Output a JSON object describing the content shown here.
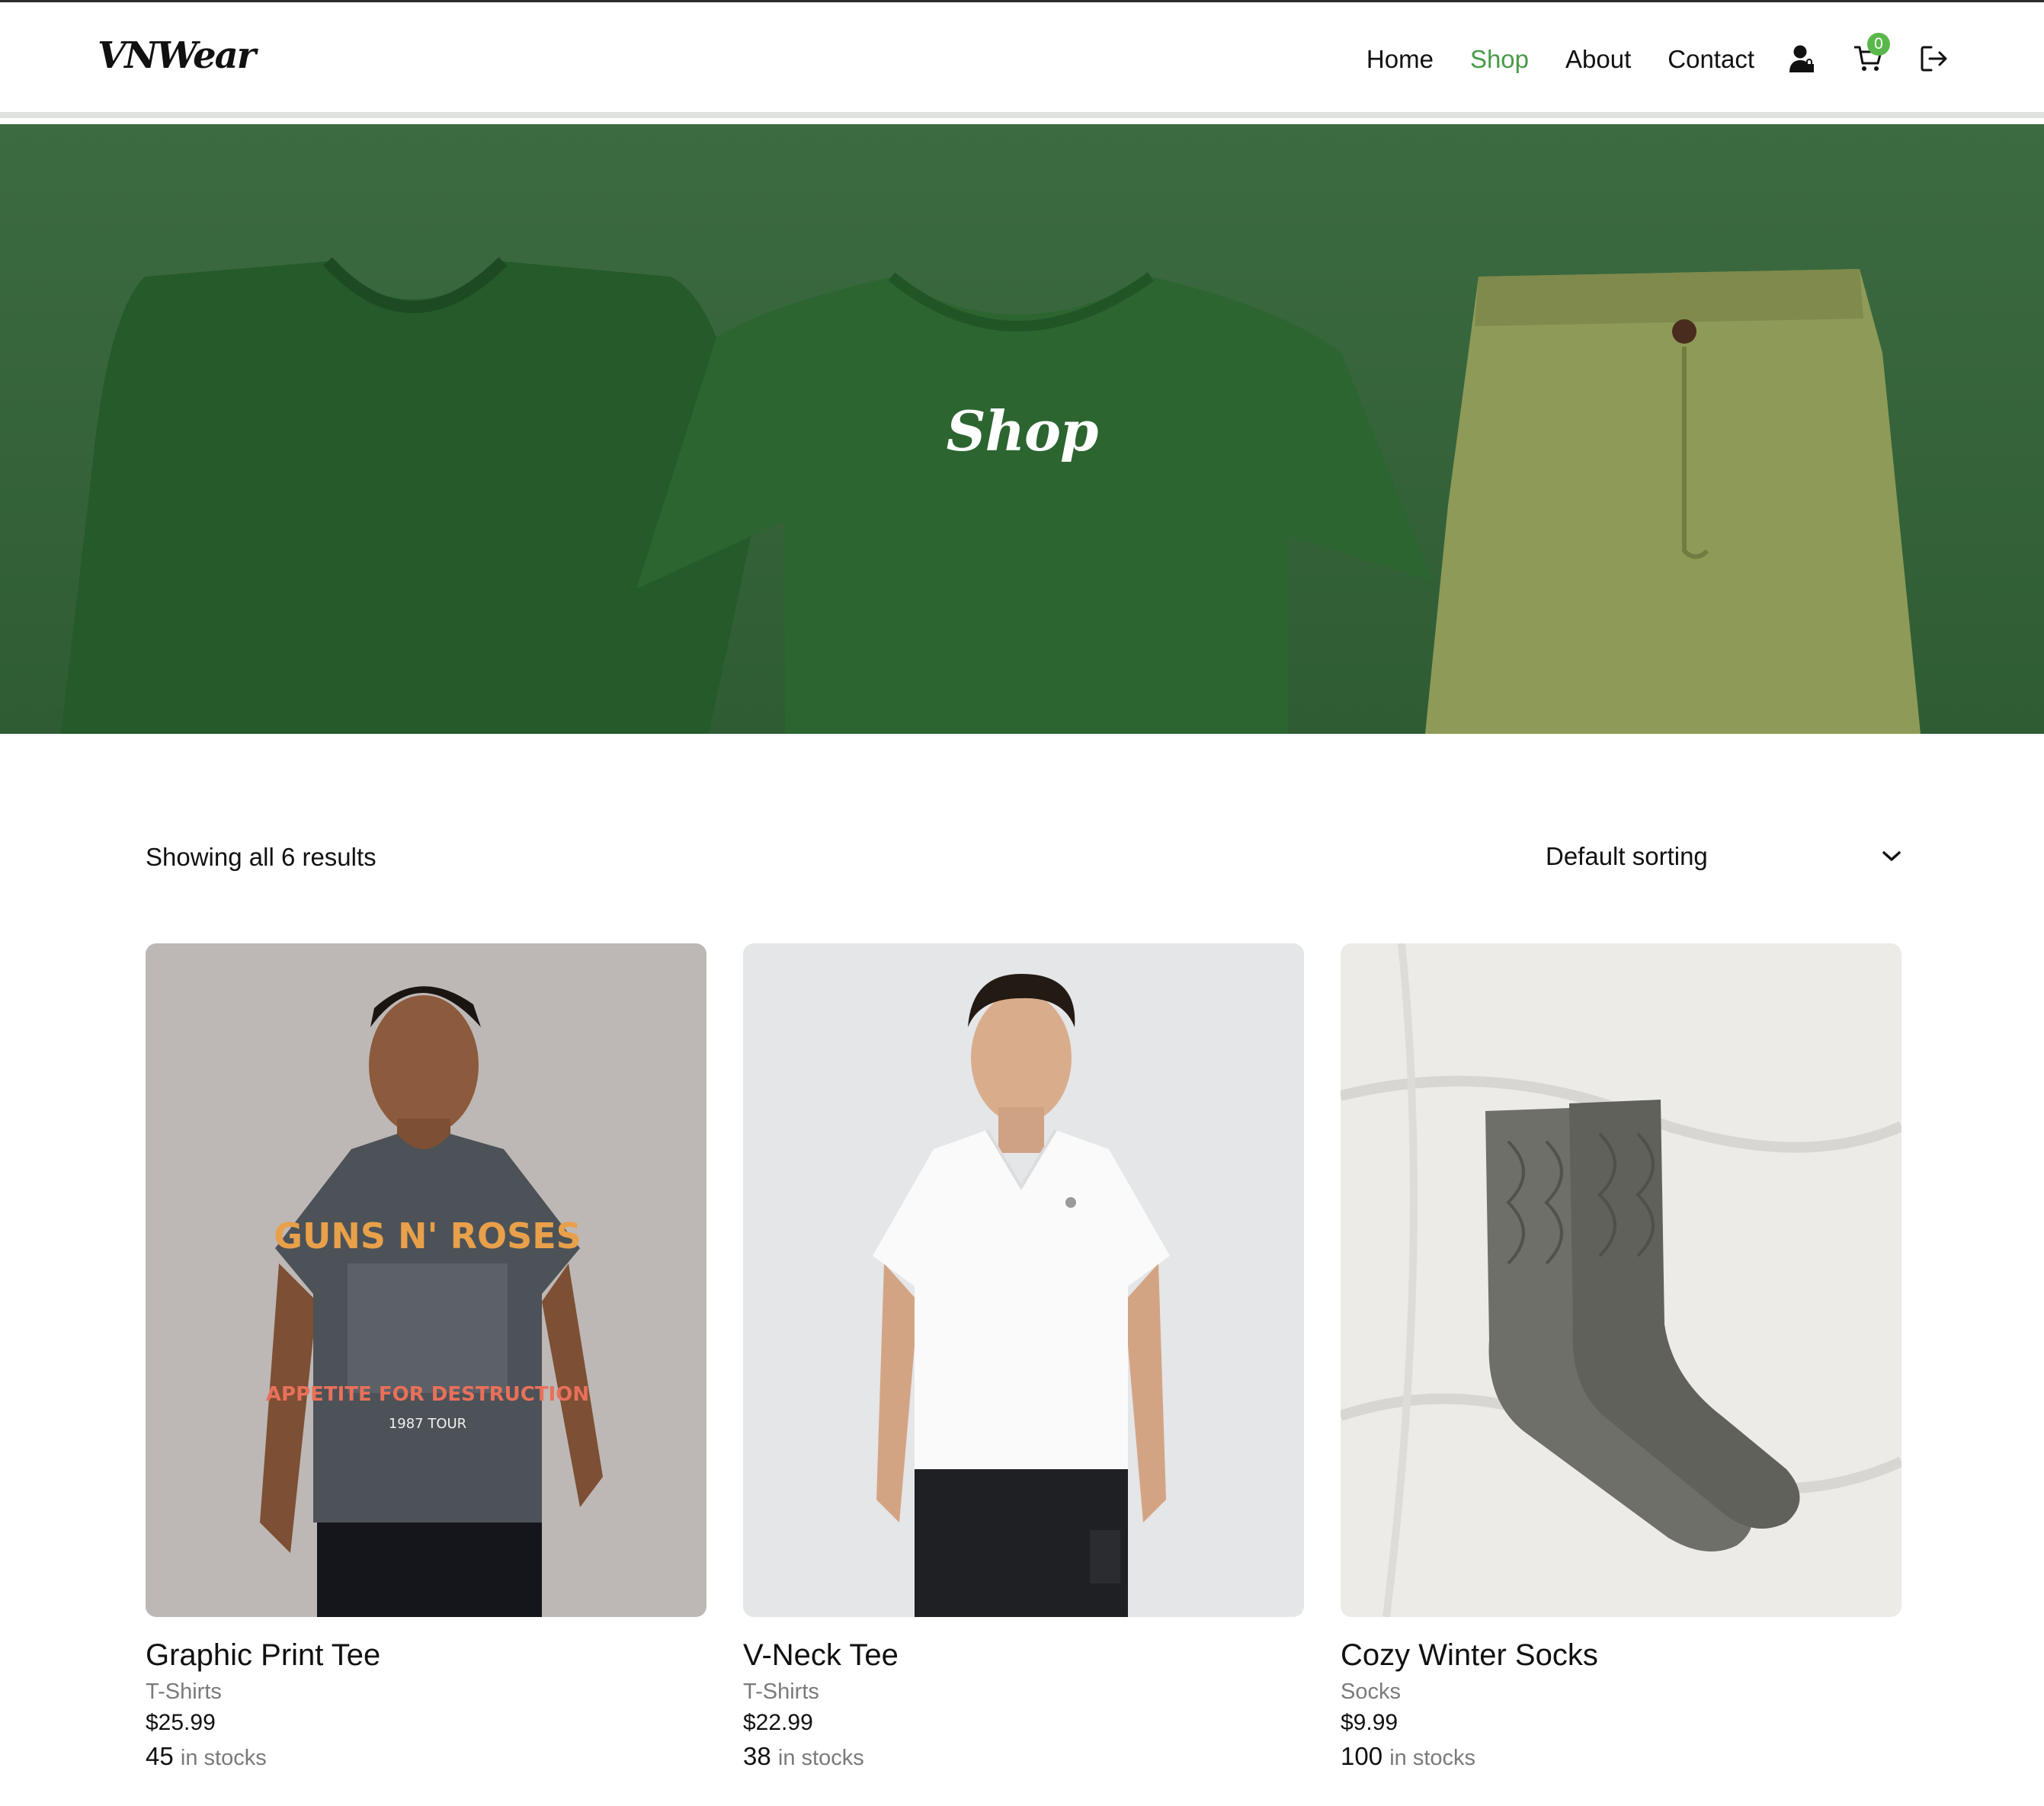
{
  "brand": {
    "logo": "VNWear"
  },
  "nav": {
    "items": [
      {
        "label": "Home",
        "active": false
      },
      {
        "label": "Shop",
        "active": true
      },
      {
        "label": "About",
        "active": false
      },
      {
        "label": "Contact",
        "active": false
      }
    ],
    "icons": [
      "user-icon",
      "cart-icon",
      "logout-icon"
    ],
    "cart_count": "0",
    "active_color": "#4a9a47"
  },
  "hero": {
    "title": "Shop",
    "background_color": "#3a6a3e"
  },
  "toolbar": {
    "result_count": "Showing all 6 results",
    "sort_selected": "Default sorting"
  },
  "products": [
    {
      "name": "Graphic Print Tee",
      "category": "T-Shirts",
      "price": "$25.99",
      "stock": "45",
      "stock_unit": "in stocks"
    },
    {
      "name": "V-Neck Tee",
      "category": "T-Shirts",
      "price": "$22.99",
      "stock": "38",
      "stock_unit": "in stocks"
    },
    {
      "name": "Cozy Winter Socks",
      "category": "Socks",
      "price": "$9.99",
      "stock": "100",
      "stock_unit": "in stocks"
    }
  ]
}
